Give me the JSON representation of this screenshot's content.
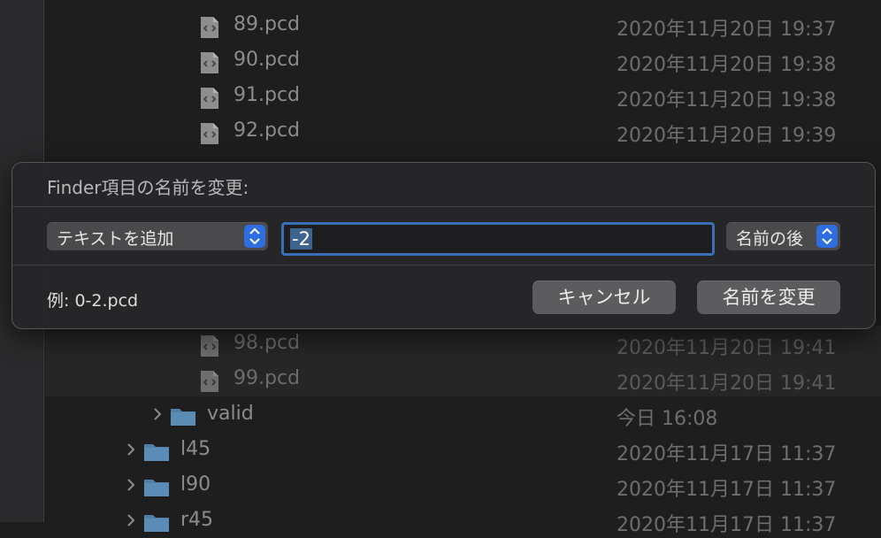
{
  "files": [
    {
      "name": "89.pcd",
      "date": "2020年11月20日 19:37"
    },
    {
      "name": "90.pcd",
      "date": "2020年11月20日 19:38"
    },
    {
      "name": "91.pcd",
      "date": "2020年11月20日 19:38"
    },
    {
      "name": "92.pcd",
      "date": "2020年11月20日 19:39"
    },
    {
      "name": "98.pcd",
      "date": "2020年11月20日 19:41"
    },
    {
      "name": "99.pcd",
      "date": "2020年11月20日 19:41"
    }
  ],
  "folders": [
    {
      "name": "valid",
      "date": "今日 16:08"
    },
    {
      "name": "l45",
      "date": "2020年11月17日 11:37"
    },
    {
      "name": "l90",
      "date": "2020年11月17日 11:37"
    },
    {
      "name": "r45",
      "date": "2020年11月17日 11:37"
    }
  ],
  "dialog": {
    "title": "Finder項目の名前を変更:",
    "mode": "テキストを追加",
    "text_value": "-2",
    "position": "名前の後",
    "example": "例: 0-2.pcd",
    "cancel_label": "キャンセル",
    "rename_label": "名前を変更"
  },
  "colors": {
    "accent": "#2f6ee0",
    "folder": "#4f7fa6"
  },
  "icons": {
    "file": "document-icon",
    "folder": "folder-icon",
    "chevron": "chevron-right-icon"
  }
}
